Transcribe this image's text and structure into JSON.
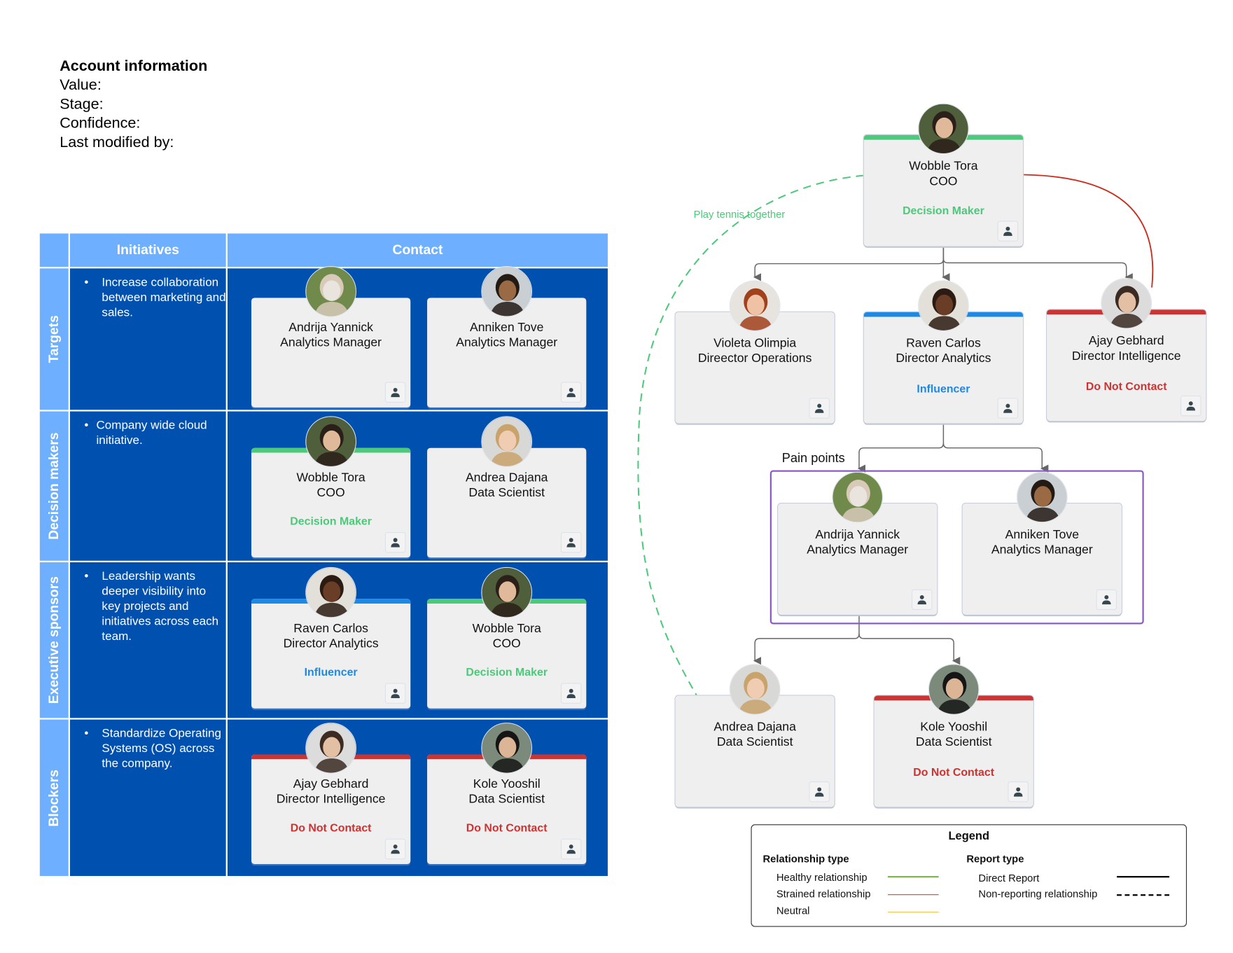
{
  "account_info": {
    "title": "Account information",
    "fields": [
      "Value:",
      "Stage:",
      "Confidence:",
      "Last modified by:"
    ]
  },
  "table": {
    "headers": [
      "Initiatives",
      "Contact"
    ],
    "rows": [
      {
        "label": "Targets",
        "initiative": "Increase collaboration between marketing and sales.",
        "contacts": [
          {
            "name": "Andrija Yannick",
            "title": "Analytics Manager",
            "role": "",
            "role_color": ""
          },
          {
            "name": "Anniken Tove",
            "title": "Analytics Manager",
            "role": "",
            "role_color": ""
          }
        ]
      },
      {
        "label": "Decision makers",
        "initiative": "Company wide cloud initiative.",
        "contacts": [
          {
            "name": "Wobble Tora",
            "title": "COO",
            "role": "Decision Maker",
            "role_color": "#4cc97a"
          },
          {
            "name": "Andrea Dajana",
            "title": "Data Scientist",
            "role": "",
            "role_color": ""
          }
        ]
      },
      {
        "label": "Executive sponsors",
        "initiative": "Leadership wants deeper visibility into key projects and initiatives across each team.",
        "contacts": [
          {
            "name": "Raven Carlos",
            "title": "Director Analytics",
            "role": "Influencer",
            "role_color": "#1e88e5"
          },
          {
            "name": "Wobble Tora",
            "title": "COO",
            "role": "Decision Maker",
            "role_color": "#4cc97a"
          }
        ]
      },
      {
        "label": "Blockers",
        "initiative": "Standardize Operating Systems (OS) across the company.",
        "contacts": [
          {
            "name": "Ajay Gebhard",
            "title": "Director Intelligence",
            "role": "Do Not Contact",
            "role_color": "#cc3333"
          },
          {
            "name": "Kole Yooshil",
            "title": "Data Scientist",
            "role": "Do Not Contact",
            "role_color": "#cc3333"
          }
        ]
      }
    ]
  },
  "org_chart": {
    "relationship_label": "Play tennis together",
    "group_label": "Pain points",
    "nodes": {
      "wobble": {
        "name": "Wobble Tora",
        "title": "COO",
        "role": "Decision Maker",
        "role_color": "#4cc97a"
      },
      "violeta": {
        "name": "Violeta Olimpia",
        "title": "Direector Operations",
        "role": "",
        "role_color": ""
      },
      "raven": {
        "name": "Raven Carlos",
        "title": "Director Analytics",
        "role": "Influencer",
        "role_color": "#1e88e5"
      },
      "ajay": {
        "name": "Ajay Gebhard",
        "title": "Director Intelligence",
        "role": "Do Not Contact",
        "role_color": "#cc3333"
      },
      "andrija": {
        "name": "Andrija Yannick",
        "title": "Analytics Manager",
        "role": "",
        "role_color": ""
      },
      "anniken": {
        "name": "Anniken Tove",
        "title": "Analytics Manager",
        "role": "",
        "role_color": ""
      },
      "andrea": {
        "name": "Andrea Dajana",
        "title": "Data Scientist",
        "role": "",
        "role_color": ""
      },
      "kole": {
        "name": "Kole Yooshil",
        "title": "Data Scientist",
        "role": "Do Not Contact",
        "role_color": "#cc3333"
      }
    }
  },
  "legend": {
    "title": "Legend",
    "relationship_type": {
      "heading": "Relationship type",
      "items": [
        {
          "label": "Healthy relationship",
          "color": "#7cb94a"
        },
        {
          "label": "Strained relationship",
          "color": "#d04a2e"
        },
        {
          "label": "Neutral",
          "color": "#f4c542"
        }
      ]
    },
    "report_type": {
      "heading": "Report type",
      "items": [
        {
          "label": "Direct Report",
          "style": "solid"
        },
        {
          "label": "Non-reporting relationship",
          "style": "dashed"
        }
      ]
    }
  },
  "colors": {
    "header_blue": "#6eb0ff",
    "cell_blue": "#0050b0",
    "decision_maker": "#4cc97a",
    "influencer": "#1e88e5",
    "do_not_contact": "#cc3333",
    "pain_points_border": "#8a5cc8"
  }
}
